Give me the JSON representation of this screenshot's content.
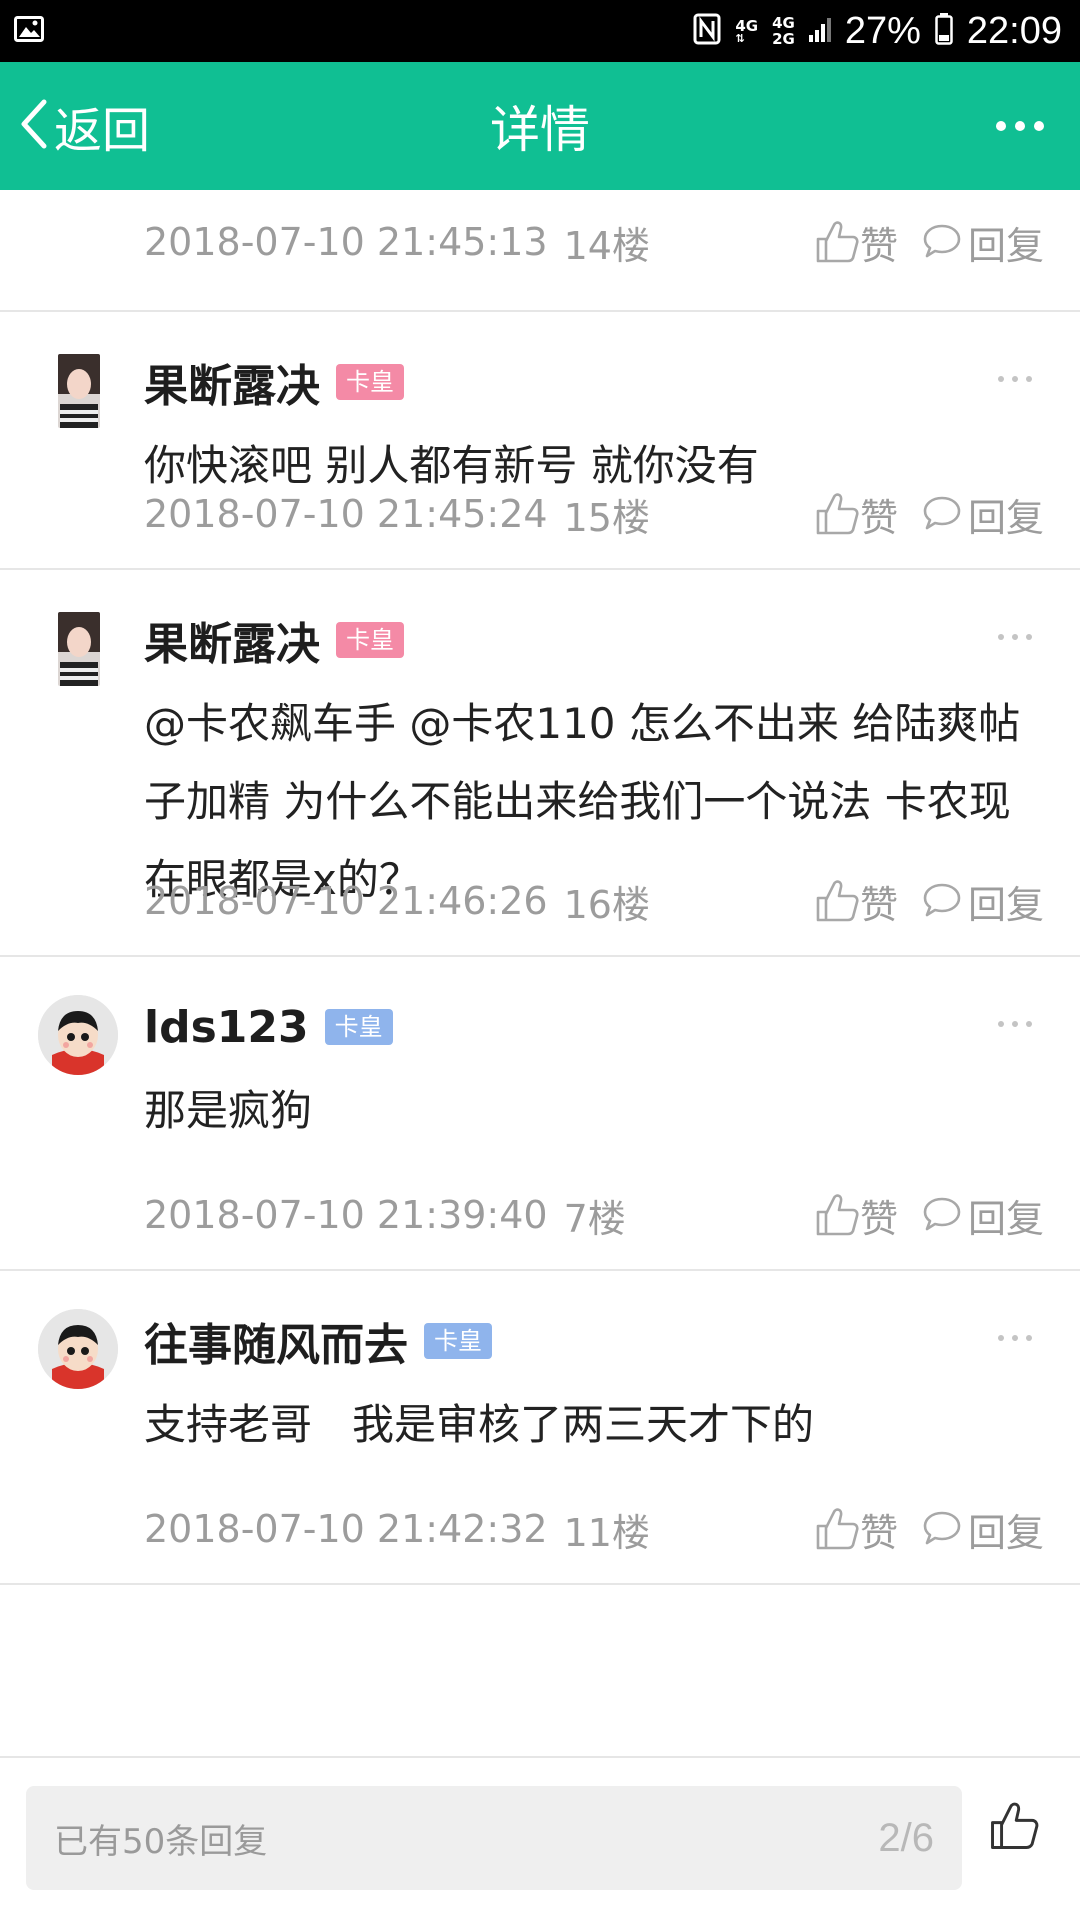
{
  "status_bar": {
    "net_top": "4G",
    "net_mid": "4G",
    "net_bot": "2G",
    "battery": "27%",
    "time": "22:09",
    "icons": [
      "image-icon",
      "nfc-icon",
      "signal-icon",
      "battery-icon"
    ]
  },
  "header": {
    "back_label": "返回",
    "title": "详情",
    "accent": "#10bf93"
  },
  "posts": [
    {
      "name": "",
      "badge": "",
      "content": "",
      "time": "2018-07-10 21:45:13",
      "floor": "14楼",
      "like_label": "赞",
      "reply_label": "回复"
    },
    {
      "name": "果断露决",
      "badge": "卡皇",
      "badge_color": "#f48aa6",
      "content": "你快滚吧 别人都有新号 就你没有",
      "time": "2018-07-10 21:45:24",
      "floor": "15楼",
      "like_label": "赞",
      "reply_label": "回复"
    },
    {
      "name": "果断露决",
      "badge": "卡皇",
      "badge_color": "#f48aa6",
      "content": "@卡农飙车手 @卡农110 怎么不出来 给陆爽帖子加精 为什么不能出来给我们一个说法 卡农现在眼都是x的？",
      "time": "2018-07-10 21:46:26",
      "floor": "16楼",
      "like_label": "赞",
      "reply_label": "回复"
    },
    {
      "name": "lds123",
      "badge": "卡皇",
      "badge_color": "#8fb4ec",
      "content": "那是疯狗",
      "time": "2018-07-10 21:39:40",
      "floor": "7楼",
      "like_label": "赞",
      "reply_label": "回复"
    },
    {
      "name": "往事随风而去",
      "badge": "卡皇",
      "badge_color": "#8fb4ec",
      "content": "支持老哥   我是审核了两三天才下的",
      "time": "2018-07-10 21:42:32",
      "floor": "11楼",
      "like_label": "赞",
      "reply_label": "回复"
    }
  ],
  "bottom": {
    "reply_count": "已有50条回复",
    "page": "2/6"
  }
}
